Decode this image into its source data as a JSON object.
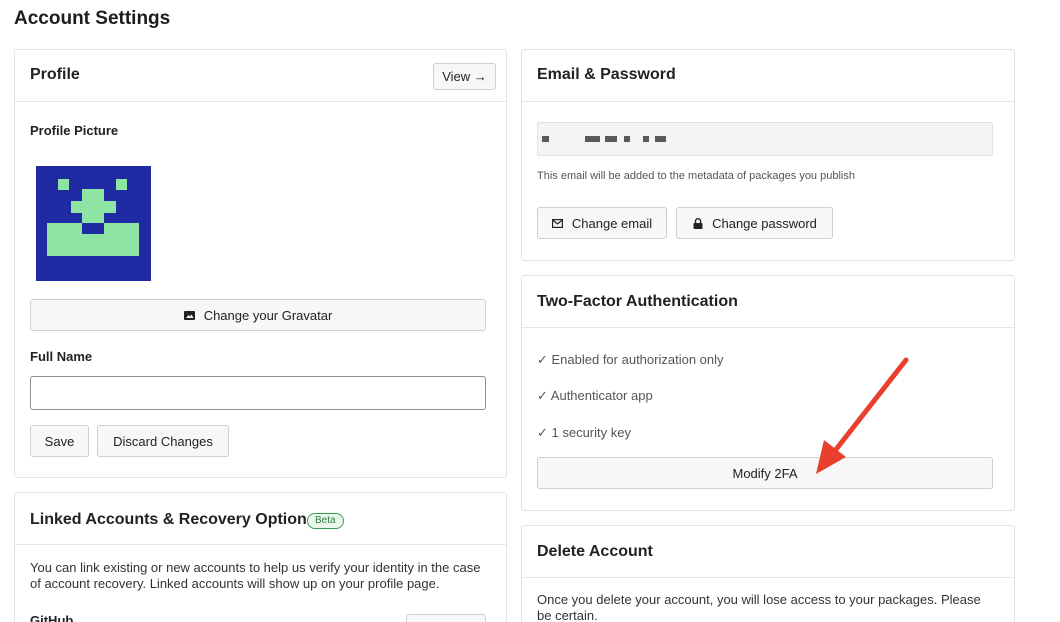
{
  "page_title": "Account Settings",
  "profile": {
    "title": "Profile",
    "view_label": "View →",
    "picture_label": "Profile Picture",
    "gravatar_label": "Change your Gravatar",
    "full_name_label": "Full Name",
    "full_name_value": "",
    "save_label": "Save",
    "discard_label": "Discard Changes"
  },
  "linked": {
    "title": "Linked Accounts & Recovery Option",
    "badge": "Beta",
    "desc_line1": "You can link existing or new accounts to help us verify your identity in the case",
    "desc_line2": "of account recovery. Linked accounts will show up on your profile page.",
    "github_label": "GitHub"
  },
  "email_password": {
    "title": "Email & Password",
    "email_note": "This email will be added to the metadata of packages you publish",
    "change_email_label": "Change email",
    "change_password_label": "Change password"
  },
  "two_factor": {
    "title": "Two-Factor Authentication",
    "items": [
      "✓ Enabled for authorization only",
      "✓ Authenticator app",
      "✓ 1 security key"
    ],
    "modify_label": "Modify 2FA"
  },
  "delete_account": {
    "title": "Delete Account",
    "desc_line1": "Once you delete your account, you will lose access to your packages. Please",
    "desc_line2": "be certain."
  },
  "colors": {
    "avatar_bg": "#1f2aa3",
    "avatar_fg": "#8ee5a3",
    "arrow": "#e8402c",
    "badge_green": "#3b9b52"
  }
}
